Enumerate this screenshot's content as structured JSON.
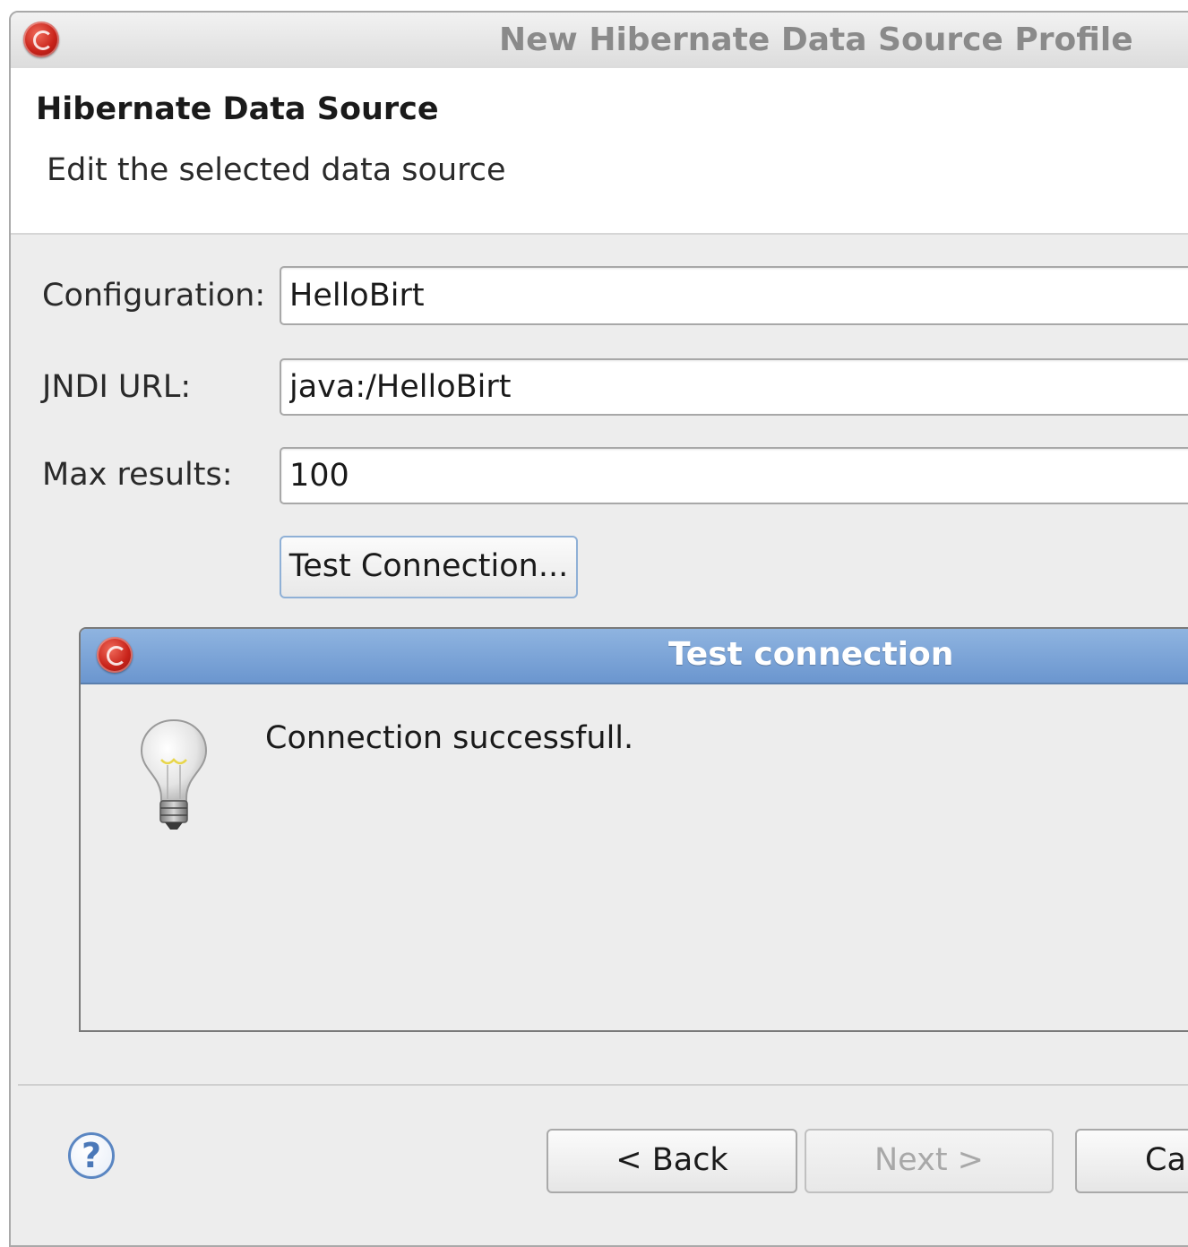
{
  "window": {
    "title": "New Hibernate Data Source Profile"
  },
  "header": {
    "title": "Hibernate Data Source",
    "description": "Edit the selected data source"
  },
  "form": {
    "configuration": {
      "label": "Configuration:",
      "value": "HelloBirt"
    },
    "jndi_url": {
      "label": "JNDI URL:",
      "value": "java:/HelloBirt"
    },
    "max_results": {
      "label": "Max results:",
      "value": "100"
    },
    "test_button_label": "Test Connection..."
  },
  "test_dialog": {
    "title": "Test connection",
    "message": "Connection successfull.",
    "icon": "lightbulb-icon"
  },
  "footer": {
    "help_icon": "?",
    "back_label": "< Back",
    "next_label": "Next >",
    "cancel_label": "Ca"
  },
  "colors": {
    "accent_title_bar": "#7aa2d6",
    "app_icon": "#c8231a",
    "help_icon": "#4a78b8"
  }
}
